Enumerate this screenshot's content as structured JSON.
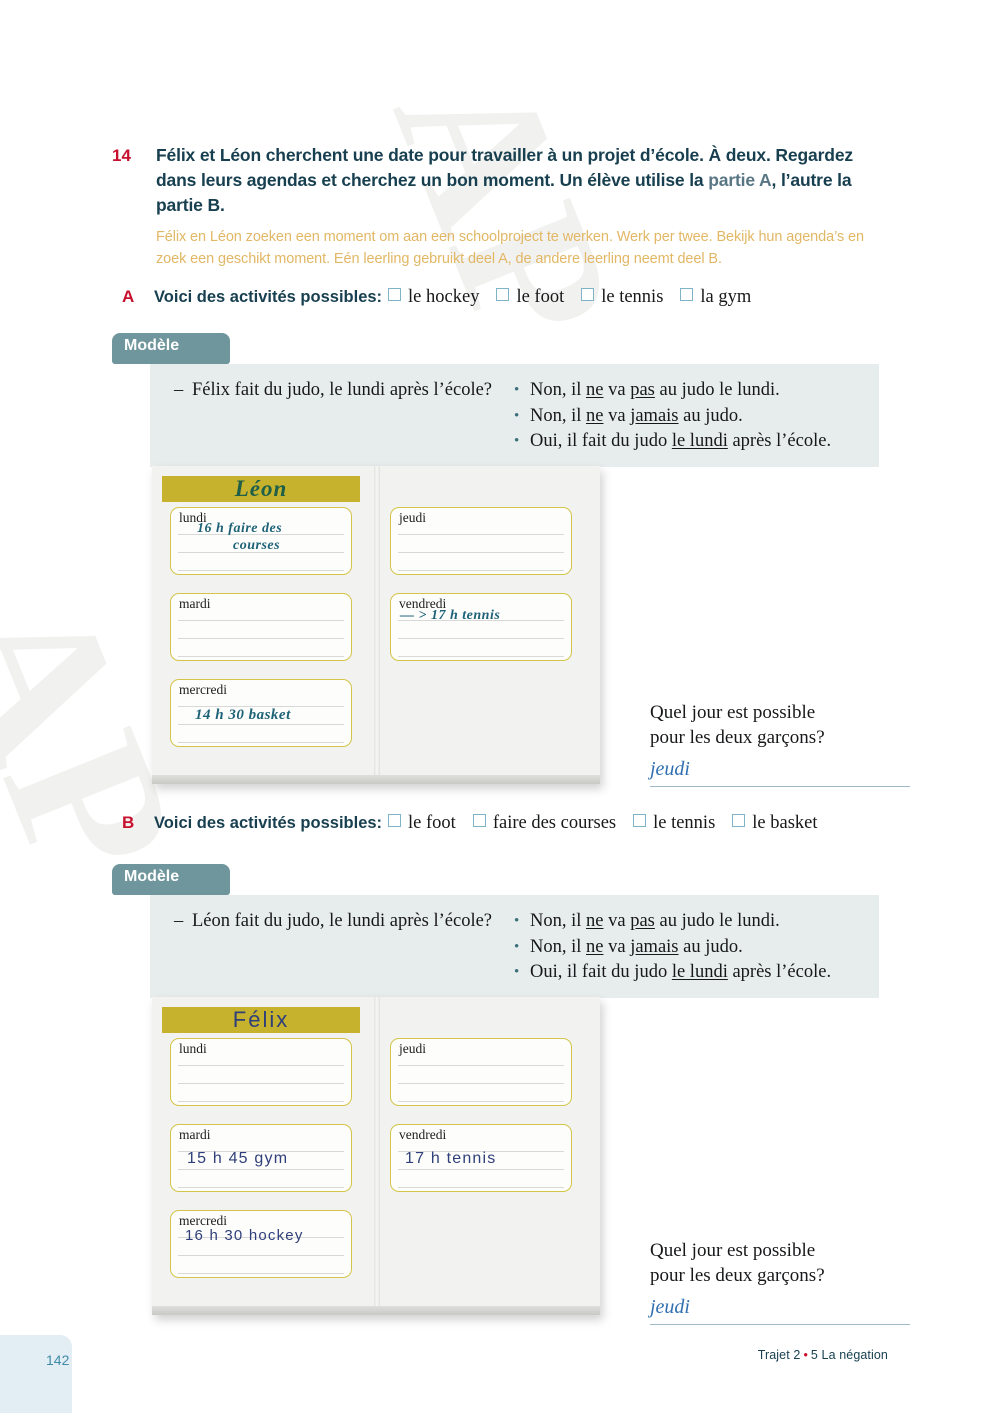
{
  "exercise": {
    "number": "14",
    "instruction_fr_part1": "Félix et Léon cherchent une date pour travailler à un projet d’école. À deux. Regardez dans leurs agendas et cherchez un bon moment. Un élève utilise la ",
    "instruction_fr_muted": "partie A",
    "instruction_fr_part2": ", l’autre la partie B.",
    "instruction_nl": "Félix en Léon zoeken een moment om aan een schoolproject te werken. Werk per twee. Bekijk hun agenda’s en zoek een geschikt moment. Eén leerling gebruikt deel A, de andere leerling neemt deel B."
  },
  "sections": [
    {
      "letter": "A",
      "label": "Voici des activités possibles:",
      "options": [
        "le hockey",
        "le foot",
        "le tennis",
        "la gym"
      ],
      "modele": {
        "tab_label": "Modèle",
        "question_dash": "–",
        "question": "Félix fait du judo, le lundi après l’école?",
        "answers": [
          {
            "pre": "Non, il ",
            "u1": "ne",
            "mid": " va ",
            "u2": "pas",
            "post": " au judo le lundi."
          },
          {
            "pre": "Non, il ",
            "u1": "ne",
            "mid": " va ",
            "u2": "jamais",
            "post": " au judo."
          },
          {
            "pre": "Oui, il fait du judo ",
            "u1": "",
            "mid": "",
            "u2": "le lundi",
            "post": " après l’école."
          }
        ]
      },
      "agenda": {
        "name": "Léon",
        "days": [
          {
            "label": "lundi",
            "entry_line1": "16 h faire des",
            "entry_line2": "courses",
            "style": "script"
          },
          {
            "label": "mardi",
            "entry_line1": "",
            "entry_line2": "",
            "style": "script"
          },
          {
            "label": "mercredi",
            "entry_line1": "14 h 30 basket",
            "entry_line2": "",
            "style": "script"
          },
          {
            "label": "jeudi",
            "entry_line1": "",
            "entry_line2": "",
            "style": "script"
          },
          {
            "label": "vendredi",
            "entry_line1": "— > 17 h tennis",
            "entry_line2": "",
            "style": "script"
          }
        ]
      },
      "question_block": {
        "line1": "Quel jour est possible",
        "line2": "pour les deux garçons?",
        "answer": "jeudi"
      }
    },
    {
      "letter": "B",
      "label": "Voici des activités possibles:",
      "options": [
        "le foot",
        "faire des courses",
        "le tennis",
        "le basket"
      ],
      "modele": {
        "tab_label": "Modèle",
        "question_dash": "–",
        "question": "Léon fait du judo, le lundi après l’école?",
        "answers": [
          {
            "pre": "Non, il ",
            "u1": "ne",
            "mid": " va ",
            "u2": "pas",
            "post": " au judo le lundi."
          },
          {
            "pre": "Non, il ",
            "u1": "ne",
            "mid": " va ",
            "u2": "jamais",
            "post": " au judo."
          },
          {
            "pre": "Oui, il fait du judo ",
            "u1": "",
            "mid": "",
            "u2": "le lundi",
            "post": " après l’école."
          }
        ]
      },
      "agenda": {
        "name": "Félix",
        "days": [
          {
            "label": "lundi",
            "entry_line1": "",
            "entry_line2": "",
            "style": "print"
          },
          {
            "label": "mardi",
            "entry_line1": "15 h 45 gym",
            "entry_line2": "",
            "style": "print"
          },
          {
            "label": "mercredi",
            "entry_line1": "16 h 30 hockey",
            "entry_line2": "",
            "style": "print"
          },
          {
            "label": "jeudi",
            "entry_line1": "",
            "entry_line2": "",
            "style": "print"
          },
          {
            "label": "vendredi",
            "entry_line1": "17 h tennis",
            "entry_line2": "",
            "style": "print"
          }
        ]
      },
      "question_block": {
        "line1": "Quel jour est possible",
        "line2": "pour les deux garçons?",
        "answer": "jeudi"
      }
    }
  ],
  "watermark": {
    "line_a": "AP",
    "line_b": "AP"
  },
  "footer": {
    "page_number": "142",
    "trajet": "Trajet 2",
    "separator": "•",
    "chapter": "5  La négation"
  },
  "colors": {
    "red": "#c8102e",
    "dark_teal": "#173f4f",
    "nl_gold": "#e2b765",
    "modele_tab": "#6f969c",
    "modele_box": "#e7ecec",
    "banner_gold": "#c6b22c",
    "answer_blue": "#2f6fb0",
    "page_badge": "#e2eef4"
  }
}
